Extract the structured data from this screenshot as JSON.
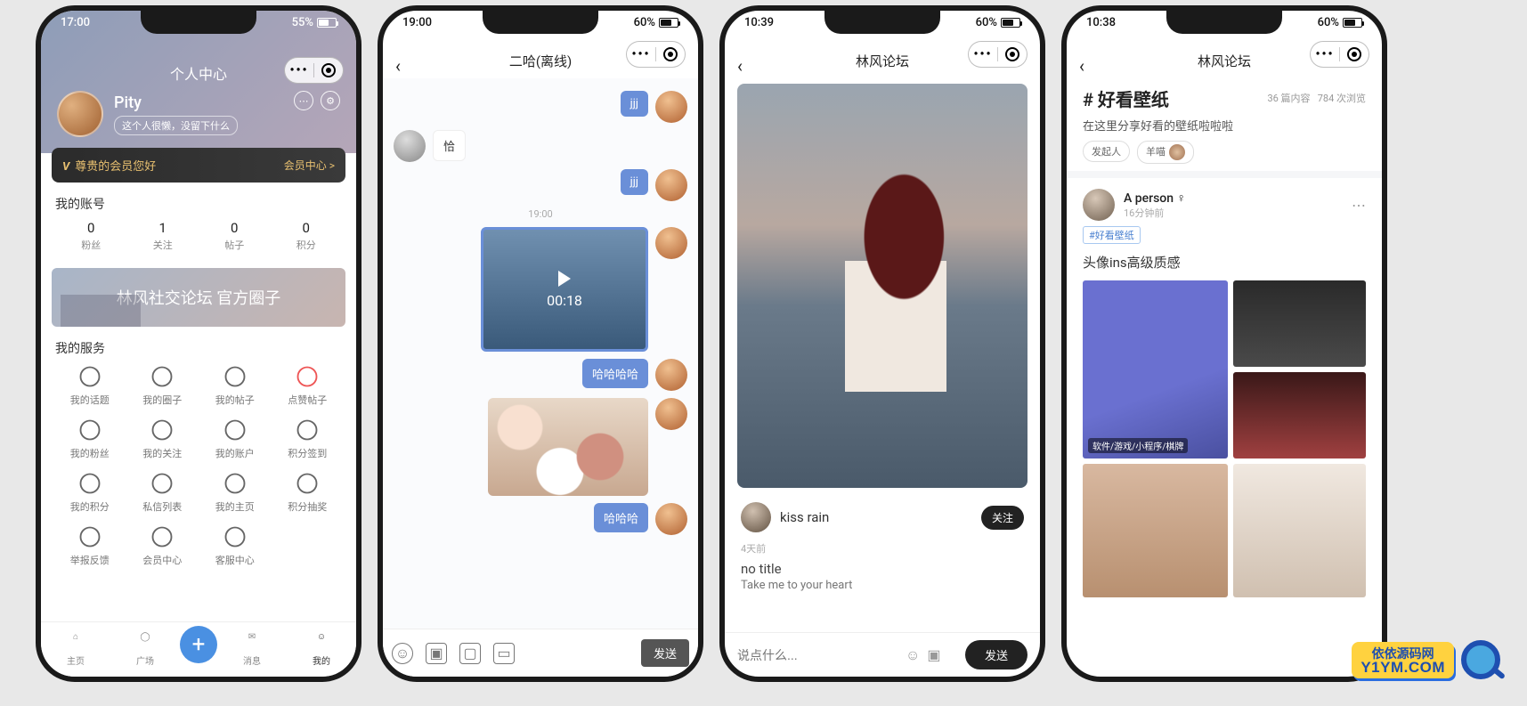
{
  "phone1": {
    "status": {
      "time": "17:00",
      "battery": "55%"
    },
    "title": "个人中心",
    "user": {
      "name": "Pity",
      "signature": "这个人很懒，没留下什么"
    },
    "vip": {
      "greet": "尊贵的会员您好",
      "center": "会员中心 >"
    },
    "account": {
      "title": "我的账号",
      "stats": [
        {
          "num": "0",
          "lbl": "粉丝"
        },
        {
          "num": "1",
          "lbl": "关注"
        },
        {
          "num": "0",
          "lbl": "帖子"
        },
        {
          "num": "0",
          "lbl": "积分"
        }
      ]
    },
    "banner": "林风社交论坛 官方圈子",
    "services": {
      "title": "我的服务",
      "items": [
        "我的话题",
        "我的圈子",
        "我的帖子",
        "点赞帖子",
        "我的粉丝",
        "我的关注",
        "我的账户",
        "积分签到",
        "我的积分",
        "私信列表",
        "我的主页",
        "积分抽奖",
        "举报反馈",
        "会员中心",
        "客服中心"
      ]
    },
    "tabs": [
      "主页",
      "广场",
      "",
      "消息",
      "我的"
    ]
  },
  "phone2": {
    "status": {
      "time": "19:00",
      "battery": "60%"
    },
    "title": "二哈(离线)",
    "messages": {
      "m1": "jjj",
      "m2": "恰",
      "m3": "jjj",
      "time": "19:00",
      "video_dur": "00:18",
      "m4": "哈哈哈哈",
      "m5": "哈哈哈"
    },
    "send": "发送"
  },
  "phone3": {
    "status": {
      "time": "10:39",
      "battery": "60%"
    },
    "title": "林风论坛",
    "author": "kiss rain",
    "follow": "关注",
    "age": "4天前",
    "post_title": "no title",
    "post_sub": "Take me to your heart",
    "placeholder": "说点什么...",
    "send": "发送"
  },
  "phone4": {
    "status": {
      "time": "10:38",
      "battery": "60%"
    },
    "title": "林风论坛",
    "topic": {
      "name": "# 好看壁纸",
      "stats_a": "36 篇内容",
      "stats_b": "784 次浏览",
      "desc": "在这里分享好看的壁纸啦啦啦",
      "chip_label": "发起人",
      "chip_user": "羊喵"
    },
    "post": {
      "name": "A person ♀",
      "time": "16分钟前",
      "tag": "#好看壁纸",
      "text": "头像ins高级质感",
      "caption": "软件/游戏/小程序/棋牌"
    }
  },
  "watermark": {
    "cn": "依依源码网",
    "en": "Y1YM.COM"
  }
}
